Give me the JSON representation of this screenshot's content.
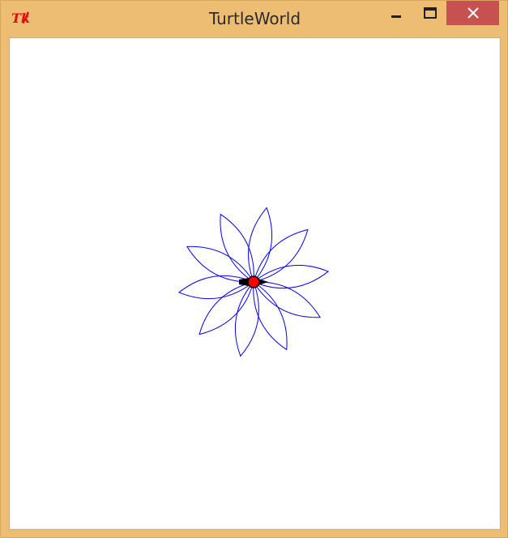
{
  "window": {
    "title": "TurtleWorld",
    "app_icon": "tk-feather-icon",
    "colors": {
      "frame": "#ecbd73",
      "close_button": "#c75050",
      "canvas_background": "#ffffff",
      "drawing": "#0000ff",
      "turtle_body": "#ff0000",
      "turtle_outline": "#000000"
    },
    "controls": {
      "minimize_icon": "minimize-icon",
      "maximize_icon": "maximize-icon",
      "close_icon": "close-icon"
    }
  },
  "canvas": {
    "drawing": {
      "shape": "flower",
      "petal_count": 10
    },
    "turtle": {
      "icon": "turtle-icon"
    }
  }
}
